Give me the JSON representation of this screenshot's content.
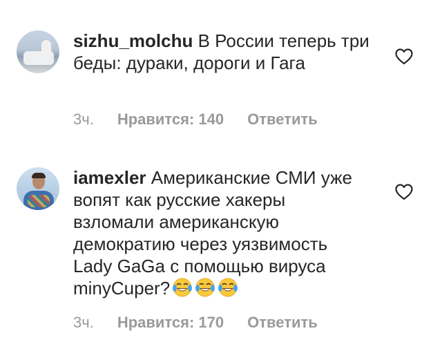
{
  "comments": [
    {
      "username": "sizhu_molchu",
      "text": "В России теперь три беды: дураки, дороги и Гага",
      "time": "3ч.",
      "likes": "Нравится: 140",
      "reply": "Ответить"
    },
    {
      "username": "iamexler",
      "text": "Американские СМИ уже вопят как русские хакеры взломали американскую демократию через уязвимость Lady GaGa с помощью вируса minyCuper?",
      "time": "3ч.",
      "likes": "Нравится: 170",
      "reply": "Ответить",
      "emoji": [
        "face-with-tears-of-joy",
        "face-with-tears-of-joy",
        "face-with-tears-of-joy"
      ]
    }
  ],
  "colors": {
    "text": "#262626",
    "meta": "#999999",
    "heart": "#262626"
  }
}
